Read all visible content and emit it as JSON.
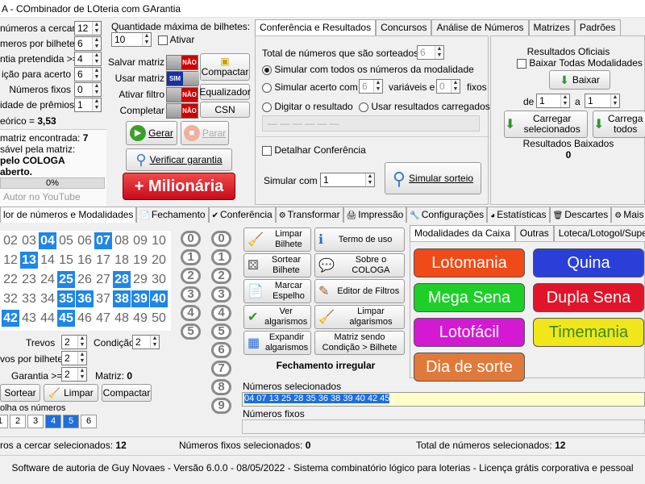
{
  "window": {
    "title": "A - COmbinador de LOteria com GArantia"
  },
  "left_panel": {
    "rows": [
      {
        "label": "números a cercar",
        "value": "12"
      },
      {
        "label": "meros por bilhete",
        "value": "6"
      },
      {
        "label": "ntia pretendida >=",
        "value": "4"
      },
      {
        "label": "ição para acerto",
        "value": "6"
      },
      {
        "label": "Números fixos",
        "value": "0"
      },
      {
        "label": "idade de prêmios",
        "value": "1"
      }
    ],
    "teorico_label": "eórico = ",
    "teorico_value": "3,53",
    "found_line": "matriz encontrada: ",
    "found_value": "7",
    "resp_line": "sável pela matriz:",
    "author_line": "pelo COLOGA",
    "aberto_line": "aberto.",
    "progress_text": "0%",
    "progress_value": 0,
    "youtube": "Autor no YouTube"
  },
  "middle_panel": {
    "qty_label": "Quantidade máxima de bilhetes:",
    "qty_value": "10",
    "ativar_label": "Ativar",
    "toggles": [
      {
        "label": "Salvar matriz",
        "state": "NÃO"
      },
      {
        "label": "Usar matriz",
        "state": "SIM"
      },
      {
        "label": "Ativar filtro",
        "state": "NÃO"
      },
      {
        "label": "Completar",
        "state": "NÃO"
      }
    ],
    "compactar": "Compactar",
    "equalizador": "Equalizador",
    "csn": "CSN",
    "gerar": "Gerar",
    "parar": "Parar",
    "verificar": "Verificar garantia",
    "milionaria": "+ Milionária"
  },
  "top_tabs": [
    "Conferência e Resultados",
    "Concursos",
    "Análise de Números",
    "Matrizes",
    "Padrões"
  ],
  "conferencia": {
    "total_label": "Total de números que são sorteados",
    "total_value": "6",
    "opt1": "Simular com todos os números da modalidade",
    "opt2_a": "Simular acerto com",
    "opt2_v1": "6",
    "opt2_b": "variáveis e",
    "opt2_v2": "0",
    "opt2_c": "fixos",
    "opt3": "Digitar o resultado",
    "opt4": "Usar resultados carregados",
    "result_dashes": "— — — — — —",
    "detalhar": "Detalhar Conferência",
    "simular_label": "Simular com",
    "simular_value": "1",
    "simular_btn": "Simular sorteio"
  },
  "resultados": {
    "title": "Resultados Oficiais",
    "baixar_todas": "Baixar Todas Modalidades",
    "baixar": "Baixar",
    "de_label": "de",
    "de_value": "1",
    "a_label": "a",
    "a_value": "1",
    "carregar_sel": "Carregar selecionados",
    "carregar_todos": "Carrega todos",
    "baixados_label": "Resultados Baixados",
    "baixados_value": "0"
  },
  "main_tabs": [
    "lor de números e Modalidades",
    "Fechamento",
    "Conferência",
    "Transformar",
    "Impressão",
    "Configurações",
    "Estatísticas",
    "Descartes",
    "Mais opç"
  ],
  "grid": {
    "rows": [
      [
        "02",
        "03",
        "04",
        "05",
        "06",
        "07",
        "08",
        "09",
        "10"
      ],
      [
        "12",
        "13",
        "14",
        "15",
        "16",
        "17",
        "18",
        "19",
        "20"
      ],
      [
        "22",
        "23",
        "24",
        "25",
        "26",
        "27",
        "28",
        "29",
        "30"
      ],
      [
        "32",
        "33",
        "34",
        "35",
        "36",
        "37",
        "38",
        "39",
        "40"
      ],
      [
        "42",
        "43",
        "44",
        "45",
        "46",
        "47",
        "48",
        "49",
        "50"
      ]
    ],
    "selected": [
      "04",
      "07",
      "13",
      "25",
      "28",
      "35",
      "36",
      "38",
      "39",
      "40",
      "42",
      "45"
    ]
  },
  "digits_col1": [
    "0",
    "1",
    "2",
    "3",
    "4",
    "5"
  ],
  "digits_col2": [
    "0",
    "1",
    "2",
    "3",
    "4",
    "5",
    "6",
    "7",
    "8",
    "9"
  ],
  "bottom_left": {
    "trevos_label": "Trevos",
    "trevos_value": "2",
    "condicao_label": "Condição",
    "condicao_value": "2",
    "tpb_label": "vos por bilhete",
    "tpb_value": "2",
    "garantia_label": "Garantia >=",
    "garantia_value": "2",
    "matriz_label": "Matriz:",
    "matriz_value": "0",
    "sortear": "Sortear",
    "limpar": "Limpar",
    "compactar": "Compactar",
    "escolha_label": "olha os números",
    "trevos": [
      "1",
      "2",
      "3",
      "4",
      "5",
      "6"
    ],
    "trevos_selected": [
      "4",
      "5"
    ]
  },
  "tools": [
    {
      "label": "Limpar Bilhete",
      "icon": "broom-icon"
    },
    {
      "label": "Termo de uso",
      "icon": "info-icon"
    },
    {
      "label": "Sortear Bilhete",
      "icon": "dice-icon"
    },
    {
      "label": "Sobre o COLOGA",
      "icon": "chat-icon"
    },
    {
      "label": "Marcar Espelho",
      "icon": "document-icon"
    },
    {
      "label": "Editor de Filtros",
      "icon": "edit-icon"
    },
    {
      "label": "Ver algarismos",
      "icon": "check-icon"
    },
    {
      "label": "Limpar algarismos",
      "icon": "broom-icon"
    },
    {
      "label": "Expandir algarismos",
      "icon": "grid-icon"
    },
    {
      "label": "Matriz sendo Condição > Bilhete",
      "icon": ""
    }
  ],
  "fechamento_status": "Fechamento irregular",
  "mod_tabs": [
    "Modalidades da Caixa",
    "Outras",
    "Loteca/Lotogol/Super Se"
  ],
  "modalidades": [
    {
      "label": "Lotomania",
      "color": "#f04a18"
    },
    {
      "label": "Quina",
      "color": "#2a3fd8"
    },
    {
      "label": "Mega Sena",
      "color": "#1ecf2a"
    },
    {
      "label": "Dupla Sena",
      "color": "#e0152a"
    },
    {
      "label": "Lotofácil",
      "color": "#d419d4"
    },
    {
      "label": "Timemania",
      "color": "#f0e61a"
    },
    {
      "label": "Dia de sorte",
      "color": "#e07a3a"
    }
  ],
  "numeros_selecionados_label": "Números selecionados",
  "numeros_selecionados_value": "04 07 13 25 28 35 36 38 39 40 42 45",
  "numeros_fixos_label": "Números fixos",
  "status": {
    "a": "ros a cercar selecionados: ",
    "a_value": "12",
    "b": "Números fixos selecionados: ",
    "b_value": "0",
    "c": "Total de números selecionados: ",
    "c_value": "12"
  },
  "footer": "Software de autoria de Guy Novaes - Versão 6.0.0 - 08/05/2022 - Sistema combinatório lógico para loterias - Licença grátis corporativa e pessoal"
}
